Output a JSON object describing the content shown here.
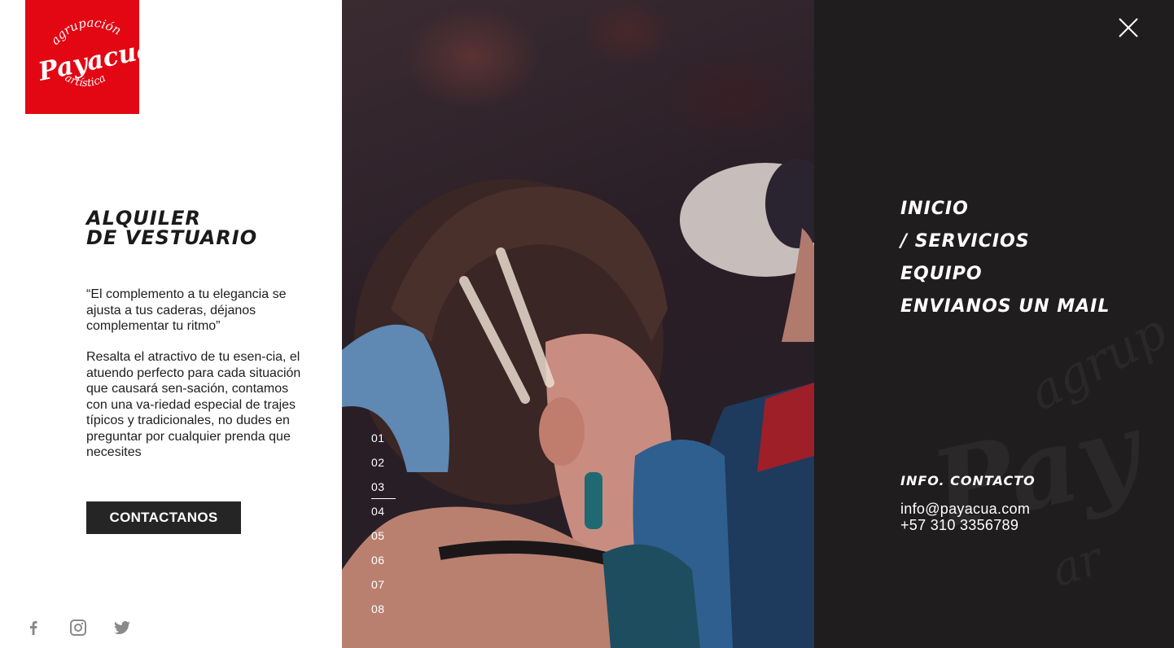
{
  "brand": {
    "logo_text_top": "agrupación",
    "logo_text_main": "Payacuá",
    "logo_text_bottom": "artística",
    "logo_color": "#e30613"
  },
  "service": {
    "title_line1": "ALQUILER",
    "title_line2": "DE VESTUARIO",
    "quote": "“El complemento a tu elegancia se ajusta a tus caderas, déjanos complementar tu ritmo”",
    "description": "Resalta el atractivo de tu esen-cia, el atuendo perfecto para cada situación que causará sen-sación, contamos con una va-riedad especial de trajes típicos y tradicionales, no dudes en preguntar por cualquier prenda que necesites",
    "cta_label": "CONTACTANOS"
  },
  "social": {
    "items": [
      {
        "icon": "facebook-icon"
      },
      {
        "icon": "instagram-icon"
      },
      {
        "icon": "twitter-icon"
      }
    ],
    "icon_color": "#8a8a8a"
  },
  "slides": {
    "items": [
      "01",
      "02",
      "03",
      "04",
      "05",
      "06",
      "07",
      "08"
    ],
    "active": "03"
  },
  "menu": {
    "close_icon": "close-icon",
    "nav": [
      "INICIO",
      "/ SERVICIOS",
      "EQUIPO",
      "ENVIANOS UN MAIL"
    ],
    "contact_label": "INFO. CONTACTO",
    "email": "info@payacua.com",
    "phone": "+57 310 3356789",
    "background": "#1f1d1e"
  }
}
